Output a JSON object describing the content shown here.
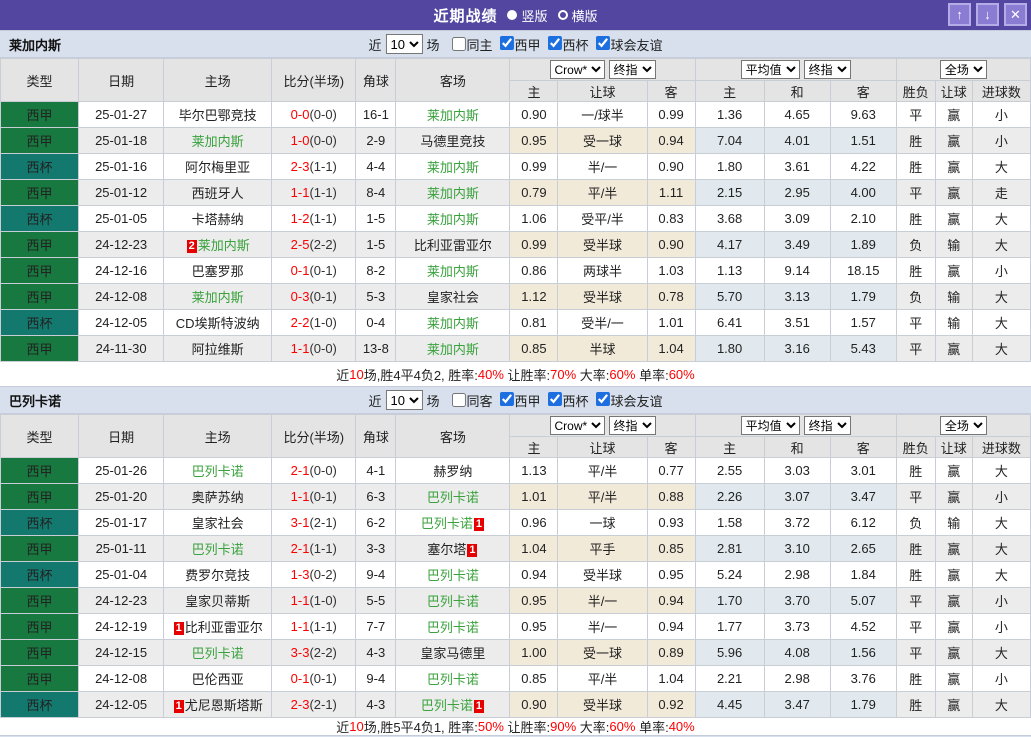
{
  "titlebar": {
    "title": "近期战绩",
    "vertical_label": "竖版",
    "horizontal_label": "横版",
    "vertical_selected": true,
    "icons": {
      "up": "↑",
      "down": "↓",
      "close": "✕"
    }
  },
  "colors": {
    "titlebar_purple": "#5246a0",
    "window_button": "#8a7cd2",
    "teambar_blue": "#d8e0ee",
    "liga_green": "#17793f",
    "cup_teal": "#13786e",
    "focus_team_green": "#39a23c",
    "win_red": "#e60000",
    "lose_blue": "#2b2bd5",
    "draw_green": "#009140",
    "score_red": "#ff0000",
    "crow_bg": "#fdf4e9",
    "avg_bg": "#ecf4f9"
  },
  "filter": {
    "near": "近",
    "count": "10",
    "matches": "场",
    "leagues": [
      "西甲",
      "西杯",
      "球会友谊"
    ],
    "leagues_checked": [
      true,
      true,
      true
    ],
    "same_checked": false
  },
  "table_header": {
    "cols": [
      "类型",
      "日期",
      "主场",
      "比分(半场)",
      "角球",
      "客场"
    ],
    "sub": [
      "主",
      "让球",
      "客",
      "主",
      "和",
      "客",
      "胜负",
      "让球",
      "进球数"
    ],
    "selects": {
      "book": "Crow*",
      "final_a": "终指",
      "avg": "平均值",
      "final_b": "终指",
      "scope": "全场"
    }
  },
  "sections": [
    {
      "team": "莱加内斯",
      "same_label": "同主",
      "rows": [
        {
          "league": "西甲",
          "cup": false,
          "date": "25-01-27",
          "hb": "",
          "home": "毕尔巴鄂竞技",
          "hf": false,
          "ft": "0-0",
          "ht": "(0-0)",
          "corner": "16-1",
          "away": "莱加内斯",
          "af": true,
          "ab": "",
          "odds": [
            "0.90",
            "一/球半",
            "0.99"
          ],
          "avg": [
            "1.36",
            "4.65",
            "9.63"
          ],
          "verdicts": [
            [
              "平",
              "g"
            ],
            [
              "赢",
              "r"
            ],
            [
              "小",
              "b"
            ]
          ]
        },
        {
          "league": "西甲",
          "cup": false,
          "date": "25-01-18",
          "hb": "",
          "home": "莱加内斯",
          "hf": true,
          "ft": "1-0",
          "ht": "(0-0)",
          "corner": "2-9",
          "away": "马德里竞技",
          "af": false,
          "ab": "",
          "odds": [
            "0.95",
            "受一球",
            "0.94"
          ],
          "avg": [
            "7.04",
            "4.01",
            "1.51"
          ],
          "verdicts": [
            [
              "胜",
              "r"
            ],
            [
              "赢",
              "r"
            ],
            [
              "小",
              "b"
            ]
          ]
        },
        {
          "league": "西杯",
          "cup": true,
          "date": "25-01-16",
          "hb": "",
          "home": "阿尔梅里亚",
          "hf": false,
          "ft": "2-3",
          "ht": "(1-1)",
          "corner": "4-4",
          "away": "莱加内斯",
          "af": true,
          "ab": "",
          "odds": [
            "0.99",
            "半/一",
            "0.90"
          ],
          "avg": [
            "1.80",
            "3.61",
            "4.22"
          ],
          "verdicts": [
            [
              "胜",
              "r"
            ],
            [
              "赢",
              "r"
            ],
            [
              "大",
              "r"
            ]
          ]
        },
        {
          "league": "西甲",
          "cup": false,
          "date": "25-01-12",
          "hb": "",
          "home": "西班牙人",
          "hf": false,
          "ft": "1-1",
          "ht": "(1-1)",
          "corner": "8-4",
          "away": "莱加内斯",
          "af": true,
          "ab": "",
          "odds": [
            "0.79",
            "平/半",
            "1.11"
          ],
          "avg": [
            "2.15",
            "2.95",
            "4.00"
          ],
          "verdicts": [
            [
              "平",
              "g"
            ],
            [
              "赢",
              "r"
            ],
            [
              "走",
              "g"
            ]
          ]
        },
        {
          "league": "西杯",
          "cup": true,
          "date": "25-01-05",
          "hb": "",
          "home": "卡塔赫纳",
          "hf": false,
          "ft": "1-2",
          "ht": "(1-1)",
          "corner": "1-5",
          "away": "莱加内斯",
          "af": true,
          "ab": "",
          "odds": [
            "1.06",
            "受平/半",
            "0.83"
          ],
          "avg": [
            "3.68",
            "3.09",
            "2.10"
          ],
          "verdicts": [
            [
              "胜",
              "r"
            ],
            [
              "赢",
              "r"
            ],
            [
              "大",
              "r"
            ]
          ]
        },
        {
          "league": "西甲",
          "cup": false,
          "date": "24-12-23",
          "hb": "2",
          "home": "莱加内斯",
          "hf": true,
          "ft": "2-5",
          "ht": "(2-2)",
          "corner": "1-5",
          "away": "比利亚雷亚尔",
          "af": false,
          "ab": "",
          "odds": [
            "0.99",
            "受半球",
            "0.90"
          ],
          "avg": [
            "4.17",
            "3.49",
            "1.89"
          ],
          "verdicts": [
            [
              "负",
              "b"
            ],
            [
              "输",
              "b"
            ],
            [
              "大",
              "r"
            ]
          ]
        },
        {
          "league": "西甲",
          "cup": false,
          "date": "24-12-16",
          "hb": "",
          "home": "巴塞罗那",
          "hf": false,
          "ft": "0-1",
          "ht": "(0-1)",
          "corner": "8-2",
          "away": "莱加内斯",
          "af": true,
          "ab": "",
          "odds": [
            "0.86",
            "两球半",
            "1.03"
          ],
          "avg": [
            "1.13",
            "9.14",
            "18.15"
          ],
          "verdicts": [
            [
              "胜",
              "r"
            ],
            [
              "赢",
              "r"
            ],
            [
              "小",
              "b"
            ]
          ]
        },
        {
          "league": "西甲",
          "cup": false,
          "date": "24-12-08",
          "hb": "",
          "home": "莱加内斯",
          "hf": true,
          "ft": "0-3",
          "ht": "(0-1)",
          "corner": "5-3",
          "away": "皇家社会",
          "af": false,
          "ab": "",
          "odds": [
            "1.12",
            "受半球",
            "0.78"
          ],
          "avg": [
            "5.70",
            "3.13",
            "1.79"
          ],
          "verdicts": [
            [
              "负",
              "b"
            ],
            [
              "输",
              "b"
            ],
            [
              "大",
              "r"
            ]
          ]
        },
        {
          "league": "西杯",
          "cup": true,
          "date": "24-12-05",
          "hb": "",
          "home": "CD埃斯特波纳",
          "hf": false,
          "ft": "2-2",
          "ht": "(1-0)",
          "corner": "0-4",
          "away": "莱加内斯",
          "af": true,
          "ab": "",
          "odds": [
            "0.81",
            "受半/一",
            "1.01"
          ],
          "avg": [
            "6.41",
            "3.51",
            "1.57"
          ],
          "verdicts": [
            [
              "平",
              "g"
            ],
            [
              "输",
              "b"
            ],
            [
              "大",
              "r"
            ]
          ]
        },
        {
          "league": "西甲",
          "cup": false,
          "date": "24-11-30",
          "hb": "",
          "home": "阿拉维斯",
          "hf": false,
          "ft": "1-1",
          "ht": "(0-0)",
          "corner": "13-8",
          "away": "莱加内斯",
          "af": true,
          "ab": "",
          "odds": [
            "0.85",
            "半球",
            "1.04"
          ],
          "avg": [
            "1.80",
            "3.16",
            "5.43"
          ],
          "verdicts": [
            [
              "平",
              "g"
            ],
            [
              "赢",
              "r"
            ],
            [
              "大",
              "r"
            ]
          ]
        }
      ],
      "summary": [
        {
          "t": "近"
        },
        {
          "t": "10",
          "red": true
        },
        {
          "t": "场,胜4平4负2, 胜率:"
        },
        {
          "t": "40%",
          "red": true
        },
        {
          "t": " 让胜率:"
        },
        {
          "t": "70%",
          "red": true
        },
        {
          "t": " 大率:"
        },
        {
          "t": "60%",
          "red": true
        },
        {
          "t": " 单率:"
        },
        {
          "t": "60%",
          "red": true
        }
      ]
    },
    {
      "team": "巴列卡诺",
      "same_label": "同客",
      "rows": [
        {
          "league": "西甲",
          "cup": false,
          "date": "25-01-26",
          "hb": "",
          "home": "巴列卡诺",
          "hf": true,
          "ft": "2-1",
          "ht": "(0-0)",
          "corner": "4-1",
          "away": "赫罗纳",
          "af": false,
          "ab": "",
          "odds": [
            "1.13",
            "平/半",
            "0.77"
          ],
          "avg": [
            "2.55",
            "3.03",
            "3.01"
          ],
          "verdicts": [
            [
              "胜",
              "r"
            ],
            [
              "赢",
              "r"
            ],
            [
              "大",
              "r"
            ]
          ]
        },
        {
          "league": "西甲",
          "cup": false,
          "date": "25-01-20",
          "hb": "",
          "home": "奥萨苏纳",
          "hf": false,
          "ft": "1-1",
          "ht": "(0-1)",
          "corner": "6-3",
          "away": "巴列卡诺",
          "af": true,
          "ab": "",
          "odds": [
            "1.01",
            "平/半",
            "0.88"
          ],
          "avg": [
            "2.26",
            "3.07",
            "3.47"
          ],
          "verdicts": [
            [
              "平",
              "g"
            ],
            [
              "赢",
              "r"
            ],
            [
              "小",
              "b"
            ]
          ]
        },
        {
          "league": "西杯",
          "cup": true,
          "date": "25-01-17",
          "hb": "",
          "home": "皇家社会",
          "hf": false,
          "ft": "3-1",
          "ht": "(2-1)",
          "corner": "6-2",
          "away": "巴列卡诺",
          "af": true,
          "ab": "1",
          "odds": [
            "0.96",
            "一球",
            "0.93"
          ],
          "avg": [
            "1.58",
            "3.72",
            "6.12"
          ],
          "verdicts": [
            [
              "负",
              "b"
            ],
            [
              "输",
              "b"
            ],
            [
              "大",
              "r"
            ]
          ]
        },
        {
          "league": "西甲",
          "cup": false,
          "date": "25-01-11",
          "hb": "",
          "home": "巴列卡诺",
          "hf": true,
          "ft": "2-1",
          "ht": "(1-1)",
          "corner": "3-3",
          "away": "塞尔塔",
          "af": false,
          "ab": "1",
          "odds": [
            "1.04",
            "平手",
            "0.85"
          ],
          "avg": [
            "2.81",
            "3.10",
            "2.65"
          ],
          "verdicts": [
            [
              "胜",
              "r"
            ],
            [
              "赢",
              "r"
            ],
            [
              "大",
              "r"
            ]
          ]
        },
        {
          "league": "西杯",
          "cup": true,
          "date": "25-01-04",
          "hb": "",
          "home": "费罗尔竞技",
          "hf": false,
          "ft": "1-3",
          "ht": "(0-2)",
          "corner": "9-4",
          "away": "巴列卡诺",
          "af": true,
          "ab": "",
          "odds": [
            "0.94",
            "受半球",
            "0.95"
          ],
          "avg": [
            "5.24",
            "2.98",
            "1.84"
          ],
          "verdicts": [
            [
              "胜",
              "r"
            ],
            [
              "赢",
              "r"
            ],
            [
              "大",
              "r"
            ]
          ]
        },
        {
          "league": "西甲",
          "cup": false,
          "date": "24-12-23",
          "hb": "",
          "home": "皇家贝蒂斯",
          "hf": false,
          "ft": "1-1",
          "ht": "(1-0)",
          "corner": "5-5",
          "away": "巴列卡诺",
          "af": true,
          "ab": "",
          "odds": [
            "0.95",
            "半/一",
            "0.94"
          ],
          "avg": [
            "1.70",
            "3.70",
            "5.07"
          ],
          "verdicts": [
            [
              "平",
              "g"
            ],
            [
              "赢",
              "r"
            ],
            [
              "小",
              "b"
            ]
          ]
        },
        {
          "league": "西甲",
          "cup": false,
          "date": "24-12-19",
          "hb": "1",
          "home": "比利亚雷亚尔",
          "hf": false,
          "ft": "1-1",
          "ht": "(1-1)",
          "corner": "7-7",
          "away": "巴列卡诺",
          "af": true,
          "ab": "",
          "odds": [
            "0.95",
            "半/一",
            "0.94"
          ],
          "avg": [
            "1.77",
            "3.73",
            "4.52"
          ],
          "verdicts": [
            [
              "平",
              "g"
            ],
            [
              "赢",
              "r"
            ],
            [
              "小",
              "b"
            ]
          ]
        },
        {
          "league": "西甲",
          "cup": false,
          "date": "24-12-15",
          "hb": "",
          "home": "巴列卡诺",
          "hf": true,
          "ft": "3-3",
          "ht": "(2-2)",
          "corner": "4-3",
          "away": "皇家马德里",
          "af": false,
          "ab": "",
          "odds": [
            "1.00",
            "受一球",
            "0.89"
          ],
          "avg": [
            "5.96",
            "4.08",
            "1.56"
          ],
          "verdicts": [
            [
              "平",
              "g"
            ],
            [
              "赢",
              "r"
            ],
            [
              "大",
              "r"
            ]
          ]
        },
        {
          "league": "西甲",
          "cup": false,
          "date": "24-12-08",
          "hb": "",
          "home": "巴伦西亚",
          "hf": false,
          "ft": "0-1",
          "ht": "(0-1)",
          "corner": "9-4",
          "away": "巴列卡诺",
          "af": true,
          "ab": "",
          "odds": [
            "0.85",
            "平/半",
            "1.04"
          ],
          "avg": [
            "2.21",
            "2.98",
            "3.76"
          ],
          "verdicts": [
            [
              "胜",
              "r"
            ],
            [
              "赢",
              "r"
            ],
            [
              "小",
              "b"
            ]
          ]
        },
        {
          "league": "西杯",
          "cup": true,
          "date": "24-12-05",
          "hb": "1",
          "home": "尤尼恩斯塔斯",
          "hf": false,
          "ft": "2-3",
          "ht": "(2-1)",
          "corner": "4-3",
          "away": "巴列卡诺",
          "af": true,
          "ab": "1",
          "odds": [
            "0.90",
            "受半球",
            "0.92"
          ],
          "avg": [
            "4.45",
            "3.47",
            "1.79"
          ],
          "verdicts": [
            [
              "胜",
              "r"
            ],
            [
              "赢",
              "r"
            ],
            [
              "大",
              "r"
            ]
          ]
        }
      ],
      "summary": [
        {
          "t": "近"
        },
        {
          "t": "10",
          "red": true
        },
        {
          "t": "场,胜5平4负1, 胜率:"
        },
        {
          "t": "50%",
          "red": true
        },
        {
          "t": " 让胜率:"
        },
        {
          "t": "90%",
          "red": true
        },
        {
          "t": " 大率:"
        },
        {
          "t": "60%",
          "red": true
        },
        {
          "t": " 单率:"
        },
        {
          "t": "40%",
          "red": true
        }
      ]
    }
  ]
}
